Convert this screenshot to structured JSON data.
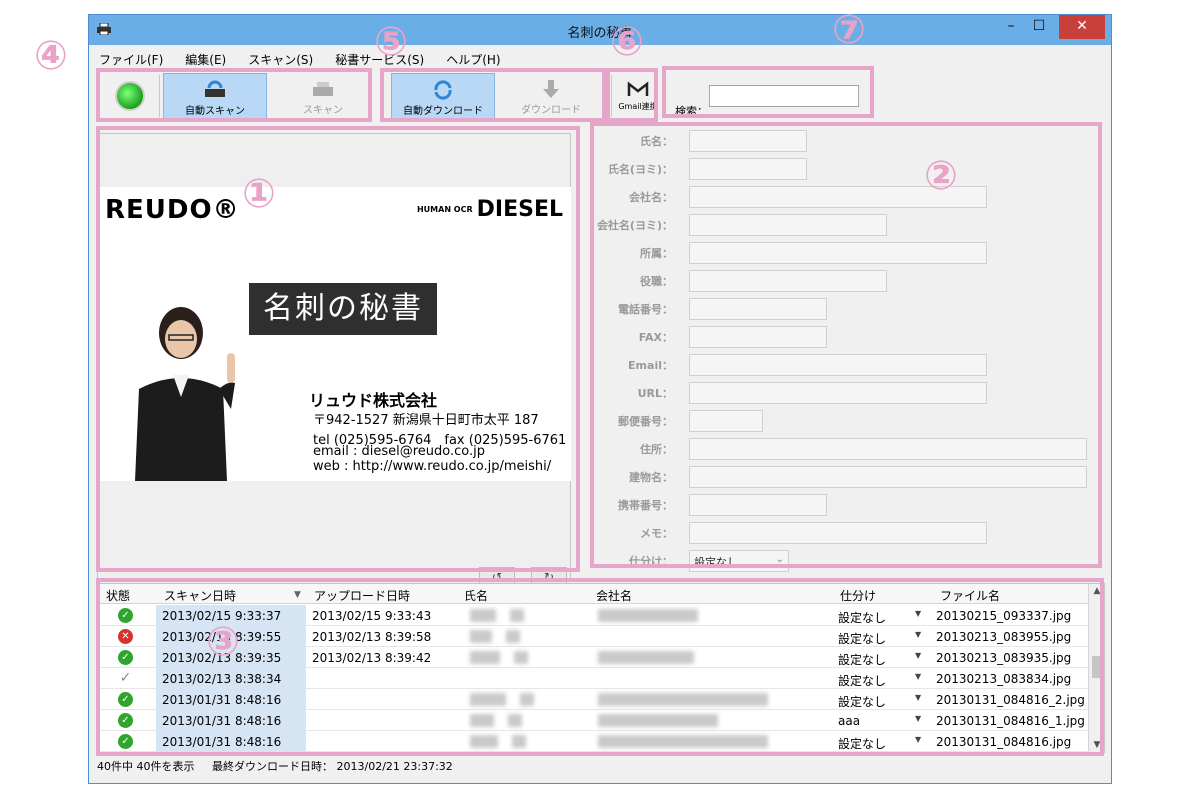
{
  "window": {
    "title": "名刺の秘書",
    "min_glyph": "–",
    "max_glyph": "☐",
    "close_glyph": "✕"
  },
  "menu": [
    "ファイル(F)",
    "編集(E)",
    "スキャン(S)",
    "秘書サービス(S)",
    "ヘルプ(H)"
  ],
  "toolbar": {
    "auto_scan": "自動スキャン",
    "scan": "スキャン",
    "auto_download": "自動ダウンロード",
    "download": "ダウンロード",
    "gmail": "Gmail連携",
    "search_label": "検索：",
    "search_value": ""
  },
  "callouts": [
    "①",
    "②",
    "③",
    "④",
    "⑤",
    "⑥",
    "⑦"
  ],
  "card": {
    "logo_left": "REUDO®",
    "logo_right_small": "HUMAN OCR",
    "logo_right": "DIESEL",
    "brand_title": "名刺の秘書",
    "company": "リュウド株式会社",
    "address": "〒942-1527 新潟県十日町市太平 187",
    "phone": "tel (025)595-6764　fax (025)595-6761",
    "email": "email : diesel@reudo.co.jp",
    "web": "web : http://www.reudo.co.jp/meishi/"
  },
  "rotate": {
    "left": "↺",
    "right": "↻"
  },
  "form_fields": [
    {
      "label": "氏名：",
      "w": 118
    },
    {
      "label": "氏名(ヨミ)：",
      "w": 118
    },
    {
      "label": "会社名：",
      "w": 298
    },
    {
      "label": "会社名(ヨミ)：",
      "w": 198
    },
    {
      "label": "所属：",
      "w": 298
    },
    {
      "label": "役職：",
      "w": 198
    },
    {
      "label": "電話番号：",
      "w": 138
    },
    {
      "label": "FAX：",
      "w": 138
    },
    {
      "label": "Email：",
      "w": 298
    },
    {
      "label": "URL：",
      "w": 298
    },
    {
      "label": "郵便番号：",
      "w": 74
    },
    {
      "label": "住所：",
      "w": 398
    },
    {
      "label": "建物名：",
      "w": 398
    },
    {
      "label": "携帯番号：",
      "w": 138
    },
    {
      "label": "メモ：",
      "w": 298
    }
  ],
  "category": {
    "label": "仕分け：",
    "value": "設定なし"
  },
  "table": {
    "headers": [
      "状態",
      "スキャン日時",
      "アップロード日時",
      "氏名",
      "会社名",
      "仕分け",
      "ファイル名"
    ],
    "rows": [
      {
        "status": "ok",
        "scan": "2013/02/15 9:33:37",
        "upload": "2013/02/15 9:33:43",
        "category": "設定なし",
        "file": "20130215_093337.jpg"
      },
      {
        "status": "err",
        "scan": "2013/02/13 8:39:55",
        "upload": "2013/02/13 8:39:58",
        "category": "設定なし",
        "file": "20130213_083955.jpg"
      },
      {
        "status": "ok",
        "scan": "2013/02/13 8:39:35",
        "upload": "2013/02/13 8:39:42",
        "category": "設定なし",
        "file": "20130213_083935.jpg"
      },
      {
        "status": "pend",
        "scan": "2013/02/13 8:38:34",
        "upload": "",
        "category": "設定なし",
        "file": "20130213_083834.jpg"
      },
      {
        "status": "ok",
        "scan": "2013/01/31 8:48:16",
        "upload": "",
        "category": "設定なし",
        "file": "20130131_084816_2.jpg"
      },
      {
        "status": "ok",
        "scan": "2013/01/31 8:48:16",
        "upload": "",
        "category": "aaa",
        "file": "20130131_084816_1.jpg"
      },
      {
        "status": "ok",
        "scan": "2013/01/31 8:48:16",
        "upload": "",
        "category": "設定なし",
        "file": "20130131_084816.jpg"
      }
    ]
  },
  "status_bar": {
    "count": "40件中 40件を表示",
    "last_download": "最終ダウンロード日時：  2013/02/21 23:37:32"
  },
  "colors": {
    "title_bar": "#6aaee7",
    "callout": "#e9a3c8",
    "accent_selected": "#b9d8f5"
  }
}
